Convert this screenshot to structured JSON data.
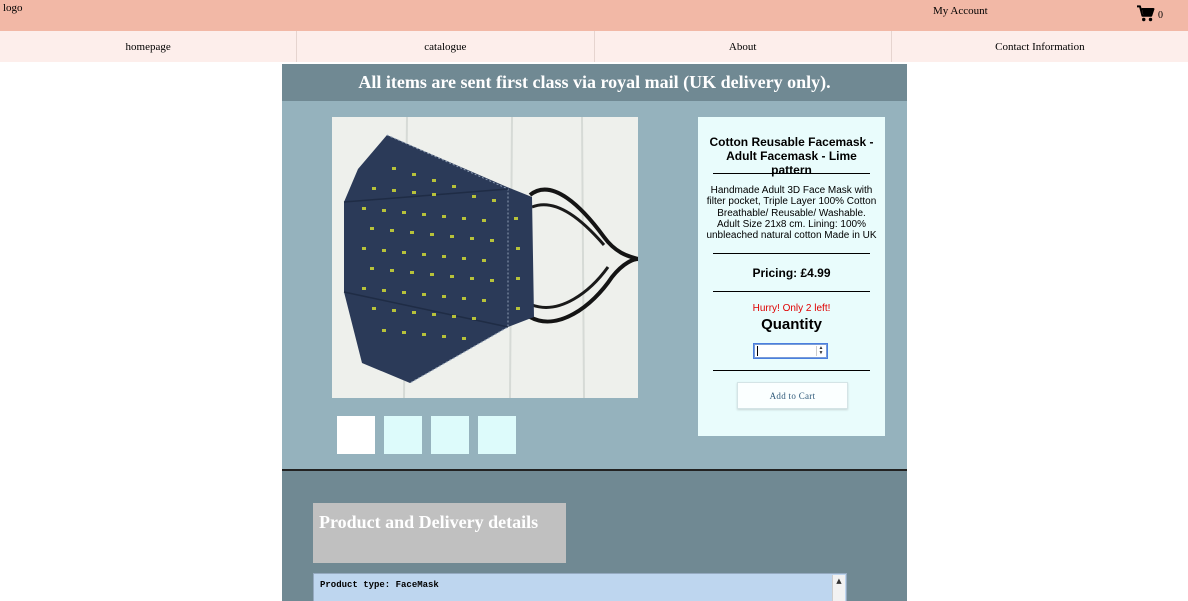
{
  "header": {
    "logo": "logo",
    "account_link": "My Account",
    "cart_icon": "shopping-cart-icon",
    "cart_count": "0"
  },
  "nav": {
    "items": [
      {
        "label": "homepage"
      },
      {
        "label": "catalogue"
      },
      {
        "label": "About"
      },
      {
        "label": "Contact Information"
      }
    ]
  },
  "banner": {
    "text": "All items are sent first class via royal mail (UK delivery only)."
  },
  "product": {
    "image_alt": "Cotton Reusable Facemask - Adult Facemask - Lime pattern",
    "title": "Cotton Reusable Facemask - Adult Facemask - Lime pattern",
    "description": "Handmade Adult 3D Face Mask with filter pocket, Triple Layer 100% Cotton Breathable/ Reusable/ Washable. Adult Size 21x8 cm. Lining: 100% unbleached natural cotton Made in UK",
    "price": "Pricing: £4.99",
    "stock_warning": "Hurry! Only 2 left!",
    "quantity_label": "Quantity",
    "quantity_value": "",
    "add_to_cart": "Add to Cart",
    "thumbnail_count": 4
  },
  "details": {
    "heading": "Product and Delivery details",
    "text": "Product type: FaceMask"
  },
  "colors": {
    "topbar": "#f2b8a6",
    "nav": "#fdeeeb",
    "main": "#95b2bd",
    "banner": "#708993",
    "panel": "#e9fcfc",
    "warning": "#e00000"
  }
}
